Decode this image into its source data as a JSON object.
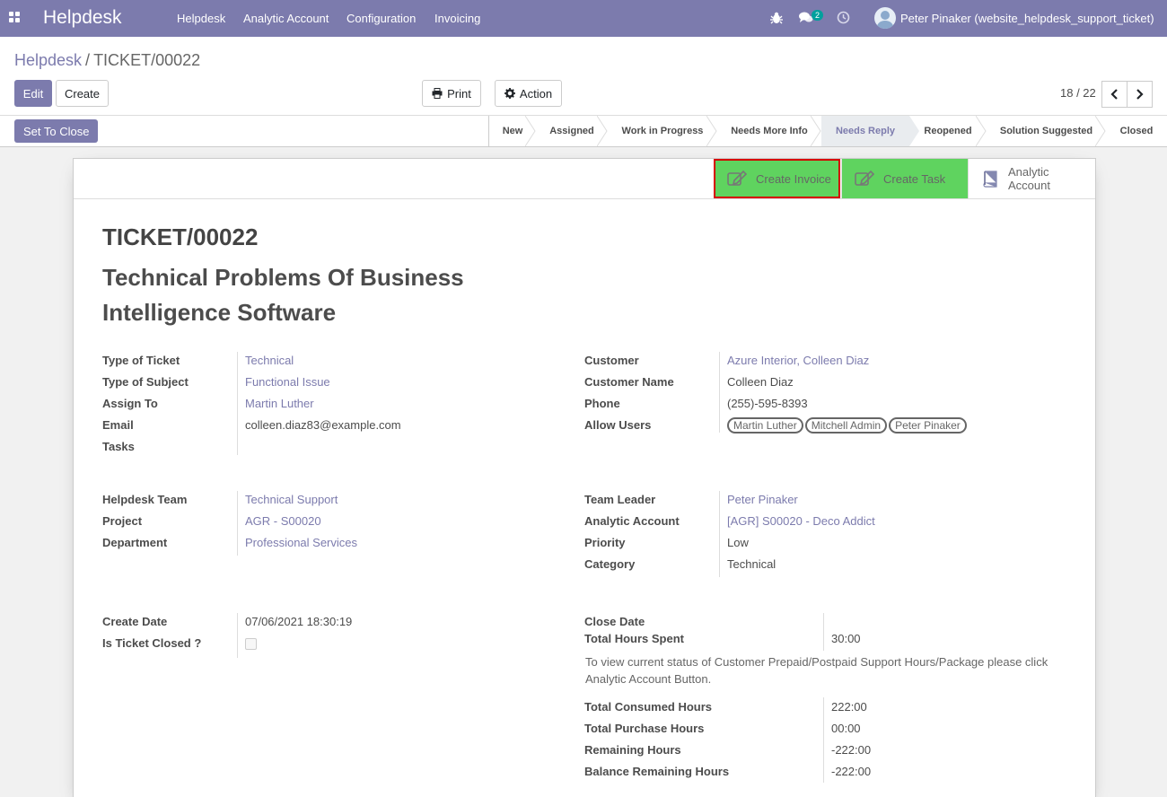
{
  "navbar": {
    "brand": "Helpdesk",
    "menu": [
      "Helpdesk",
      "Analytic Account",
      "Configuration",
      "Invoicing"
    ],
    "message_count": "2",
    "user": "Peter Pinaker (website_helpdesk_support_ticket)"
  },
  "breadcrumb": {
    "parent": "Helpdesk",
    "separator": "/",
    "current": "TICKET/00022"
  },
  "toolbar": {
    "edit": "Edit",
    "create": "Create",
    "print": "Print",
    "action": "Action",
    "pager": "18 / 22"
  },
  "statusbar": {
    "set_to_close": "Set To Close",
    "stages": [
      "New",
      "Assigned",
      "Work in Progress",
      "Needs More Info",
      "Needs Reply",
      "Reopened",
      "Solution Suggested",
      "Closed"
    ],
    "active_stage": "Needs Reply"
  },
  "smart_buttons": {
    "create_invoice": "Create Invoice",
    "create_task": "Create Task",
    "analytic_account_line1": "Analytic",
    "analytic_account_line2": "Account"
  },
  "ticket": {
    "number": "TICKET/00022",
    "subject": "Technical Problems Of Business Intelligence Software"
  },
  "left_group_1": {
    "type_of_ticket_label": "Type of Ticket",
    "type_of_ticket": "Technical",
    "type_of_subject_label": "Type of Subject",
    "type_of_subject": "Functional Issue",
    "assign_to_label": "Assign To",
    "assign_to": "Martin Luther",
    "email_label": "Email",
    "email": "colleen.diaz83@example.com",
    "tasks_label": "Tasks"
  },
  "right_group_1": {
    "customer_label": "Customer",
    "customer": "Azure Interior, Colleen Diaz",
    "customer_name_label": "Customer Name",
    "customer_name": "Colleen Diaz",
    "phone_label": "Phone",
    "phone": "(255)-595-8393",
    "allow_users_label": "Allow Users",
    "allow_users": [
      "Martin Luther",
      "Mitchell Admin",
      "Peter Pinaker"
    ]
  },
  "left_group_2": {
    "helpdesk_team_label": "Helpdesk Team",
    "helpdesk_team": "Technical Support",
    "project_label": "Project",
    "project": "AGR - S00020",
    "department_label": "Department",
    "department": "Professional Services"
  },
  "right_group_2": {
    "team_leader_label": "Team Leader",
    "team_leader": "Peter Pinaker",
    "analytic_account_label": "Analytic Account",
    "analytic_account": "[AGR] S00020 - Deco Addict",
    "priority_label": "Priority",
    "priority": "Low",
    "category_label": "Category",
    "category": "Technical"
  },
  "left_group_3": {
    "create_date_label": "Create Date",
    "create_date": "07/06/2021 18:30:19",
    "is_closed_label": "Is Ticket Closed ?"
  },
  "right_group_3": {
    "close_date_label": "Close Date",
    "total_hours_spent_label": "Total Hours Spent",
    "total_hours_spent": "30:00",
    "help": "To view current status of Customer Prepaid/Postpaid Support Hours/Package please click Analytic Account Button.",
    "consumed_label": "Total Consumed Hours",
    "consumed": "222:00",
    "purchase_label": "Total Purchase Hours",
    "purchase": "00:00",
    "remaining_label": "Remaining Hours",
    "remaining": "-222:00",
    "balance_label": "Balance Remaining Hours",
    "balance": "-222:00"
  },
  "colors": {
    "brand": "#7c7bad",
    "smart_green": "#5fd35f",
    "highlight_red": "#d60000"
  }
}
